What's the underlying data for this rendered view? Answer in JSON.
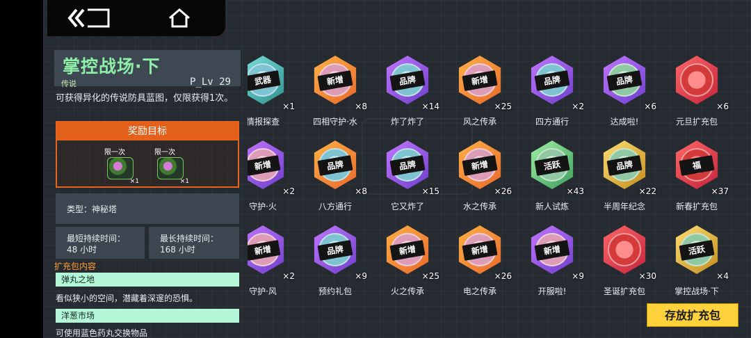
{
  "topbar": {
    "back_icon": "double-chevron-left-icon",
    "home_icon": "home-icon"
  },
  "detail": {
    "title": "掌控战场·下",
    "rarity": "传说",
    "level": "P_Lv 29",
    "description": "可获得异化的传说防具蓝图，仅限获得1次。",
    "reward_header": "奖励目标",
    "rewards": [
      {
        "limit": "限一次",
        "count": "×1"
      },
      {
        "limit": "限一次",
        "count": "×1"
      }
    ],
    "type_text": "类型：神秘塔",
    "min_label": "最短持续时间：",
    "min_value": "48 小时",
    "max_label": "最长持续时间：",
    "max_value": "168 小时",
    "section_label": "扩充包内容",
    "maps": [
      {
        "name": "弹丸之地",
        "desc": "看似狭小的空间，潜藏着深邃的恐惧。"
      },
      {
        "name": "洋葱市场",
        "desc": "可使用蓝色药丸交换物品"
      }
    ]
  },
  "packs": [
    {
      "name": "情报探查",
      "count": "×1",
      "label": "武器",
      "variant": "teal",
      "inner": "blue"
    },
    {
      "name": "四相守护·水",
      "count": "×8",
      "label": "新增",
      "variant": "orange",
      "inner": "pink"
    },
    {
      "name": "炸了炸了",
      "count": "×14",
      "label": "品牌",
      "variant": "purple",
      "inner": "blue"
    },
    {
      "name": "风之传承",
      "count": "×25",
      "label": "新增",
      "variant": "orange",
      "inner": "pink"
    },
    {
      "name": "四方通行",
      "count": "×2",
      "label": "品牌",
      "variant": "purple",
      "inner": "blue"
    },
    {
      "name": "达成啦!",
      "count": "×6",
      "label": "品牌",
      "variant": "purple",
      "inner": "green"
    },
    {
      "name": "元旦扩充包",
      "count": "×6",
      "label": "",
      "variant": "red",
      "inner": "red"
    },
    {
      "name": "守护·火",
      "count": "×2",
      "label": "新增",
      "variant": "purple",
      "inner": "pink"
    },
    {
      "name": "八方通行",
      "count": "×8",
      "label": "品牌",
      "variant": "orange",
      "inner": "blue"
    },
    {
      "name": "它又炸了",
      "count": "×15",
      "label": "品牌",
      "variant": "purple",
      "inner": "blue"
    },
    {
      "name": "水之传承",
      "count": "×26",
      "label": "新增",
      "variant": "orange",
      "inner": "pink"
    },
    {
      "name": "新人试炼",
      "count": "×43",
      "label": "活跃",
      "variant": "green",
      "inner": "green"
    },
    {
      "name": "半周年纪念",
      "count": "×22",
      "label": "品牌",
      "variant": "gold",
      "inner": "green"
    },
    {
      "name": "新春扩充包",
      "count": "×37",
      "label": "福",
      "variant": "red",
      "inner": "red"
    },
    {
      "name": "守护·风",
      "count": "×2",
      "label": "新增",
      "variant": "purple",
      "inner": "pink"
    },
    {
      "name": "预约礼包",
      "count": "×9",
      "label": "品牌",
      "variant": "purple",
      "inner": "blue"
    },
    {
      "name": "火之传承",
      "count": "×25",
      "label": "新增",
      "variant": "orange",
      "inner": "pink"
    },
    {
      "name": "电之传承",
      "count": "×26",
      "label": "新增",
      "variant": "orange",
      "inner": "pink"
    },
    {
      "name": "开服啦!",
      "count": "×9",
      "label": "新增",
      "variant": "purple",
      "inner": "pink"
    },
    {
      "name": "圣诞扩充包",
      "count": "×30",
      "label": "",
      "variant": "red",
      "inner": "red"
    },
    {
      "name": "掌控战场·下",
      "count": "×4",
      "label": "活跃",
      "variant": "gold",
      "inner": "green"
    }
  ],
  "store_button": "存放扩充包"
}
